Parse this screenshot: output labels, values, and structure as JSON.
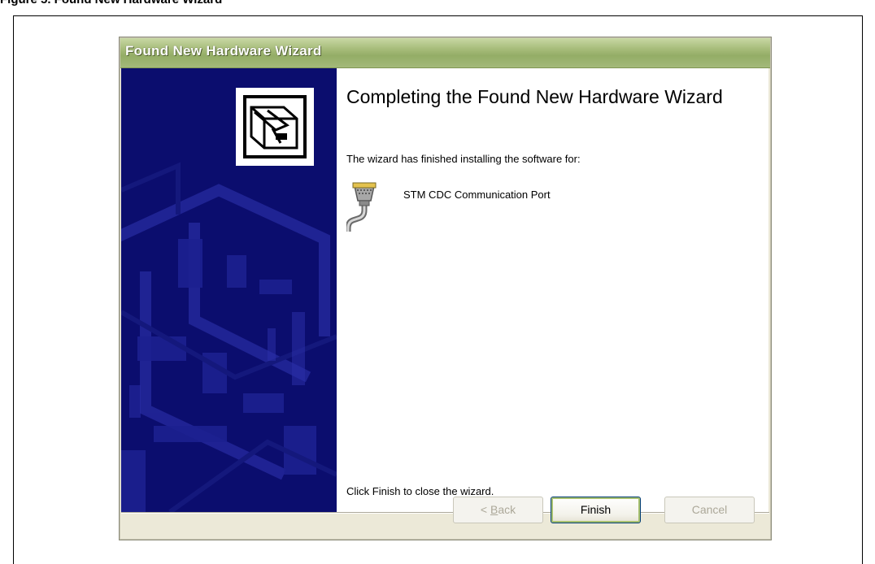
{
  "caption": {
    "left_text": "Figure 5. Found New Hardware Wizard",
    "right_text": "Found New Hardware Wizard Completing"
  },
  "window": {
    "title": "Found New Hardware Wizard"
  },
  "content": {
    "heading": "Completing the Found New Hardware Wizard",
    "intro": "The wizard has finished installing the software for:",
    "device_icon": "serial-port-cable-icon",
    "device_name": "STM CDC Communication Port",
    "footer_note": "Click Finish to close the wizard."
  },
  "buttons": {
    "back_prefix": "< ",
    "back_accel": "B",
    "back_rest": "ack",
    "finish_label": "Finish",
    "cancel_label": "Cancel"
  },
  "colors": {
    "title_bar": "#a8bd7c",
    "left_panel": "#0b0d6e",
    "dialog_background": "#ece9d8",
    "disabled_text": "#aca899"
  },
  "wizard_graphic_icon": "hardware-box-icon"
}
